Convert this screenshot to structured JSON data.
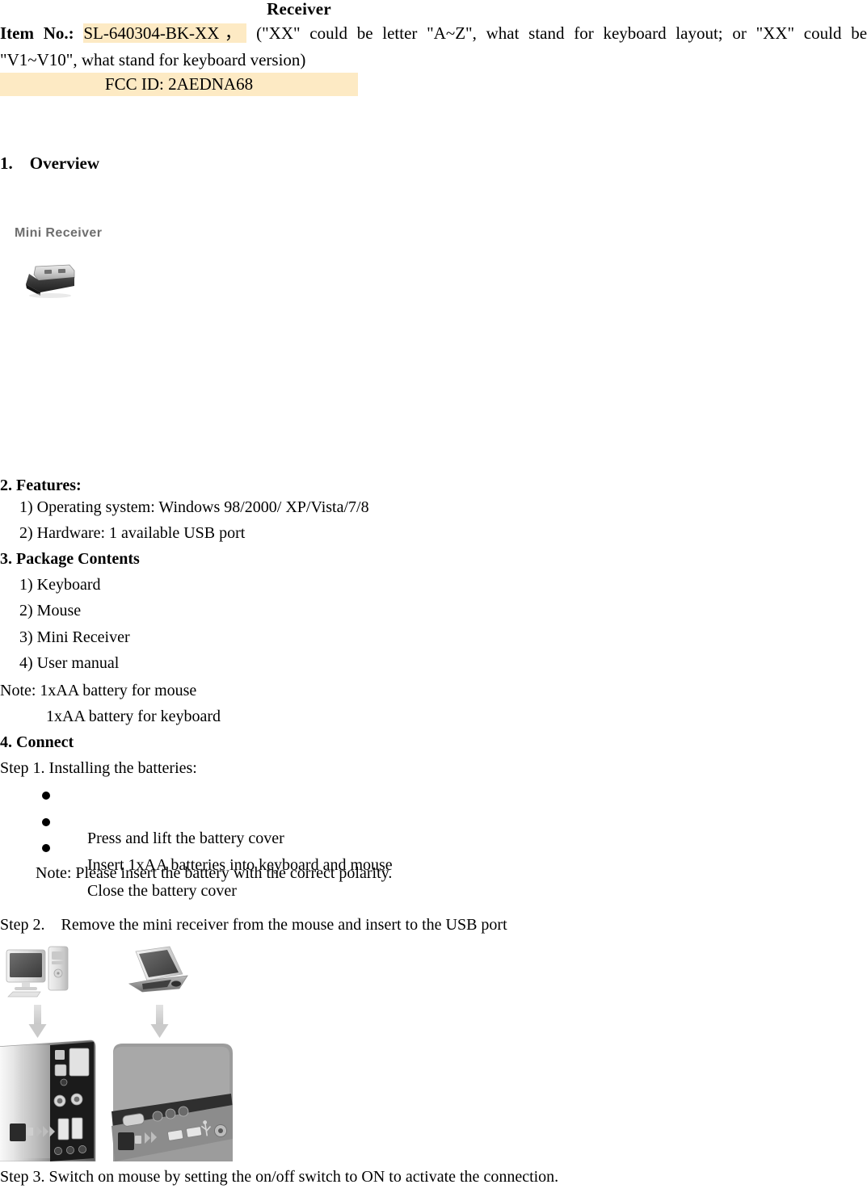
{
  "document": {
    "title": "Receiver",
    "item_label": "Item No.:",
    "item_number": "SL-640304-BK-XX，",
    "item_note_line1": "(\"XX\" could be letter \"A~Z\", what stand for keyboard layout; or \"XX\" could be",
    "item_note_line2": "\"V1~V10\", what stand for keyboard version)",
    "fcc_id": "FCC ID: 2AEDNA68",
    "highlight_color": "#fdeac4"
  },
  "sections": {
    "overview": {
      "heading": "1.    Overview",
      "figure_caption": "Mini Receiver"
    },
    "features": {
      "heading": "2. Features:",
      "items": [
        "1) Operating system: Windows 98/2000/ XP/Vista/7/8",
        "2) Hardware: 1 available USB port"
      ]
    },
    "package": {
      "heading": "3. Package Contents",
      "items": [
        "1) Keyboard",
        "2) Mouse",
        "3) Mini Receiver",
        "4) User manual"
      ],
      "note_line1": "Note: 1xAA battery for mouse",
      "note_line2": "1xAA battery for keyboard"
    },
    "connect": {
      "heading": "4. Connect",
      "step1": "Step 1. Installing the batteries:",
      "bullets": [
        "Press and lift the battery cover",
        "Insert 1xAA batteries into keyboard and mouse",
        "Close the battery cover"
      ],
      "step1_note": "Note: Please insert the battery with the correct polarity.",
      "step2": "Step 2.    Remove the mini receiver from the mouse and insert to the USB port",
      "step3": "Step 3. Switch on mouse by setting the on/off switch to ON to activate the connection."
    }
  }
}
